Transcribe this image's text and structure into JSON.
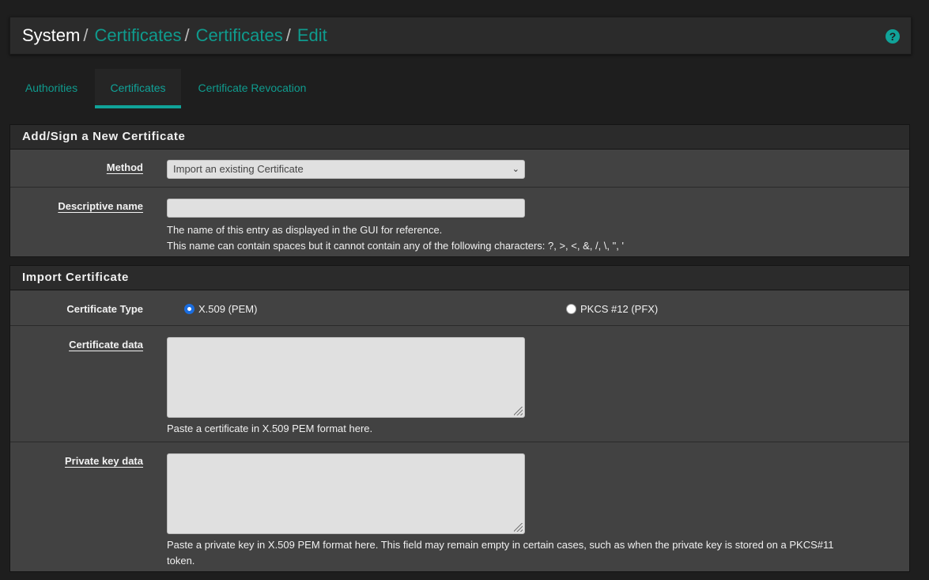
{
  "breadcrumb": {
    "system": "System",
    "sep": "/",
    "certificates_1": "Certificates",
    "certificates_2": "Certificates",
    "edit": "Edit"
  },
  "help_icon": "question-circle-icon",
  "tabs": [
    {
      "label": "Authorities",
      "active": false
    },
    {
      "label": "Certificates",
      "active": true
    },
    {
      "label": "Certificate Revocation",
      "active": false
    }
  ],
  "add_sign": {
    "heading": "Add/Sign a New Certificate",
    "method_label": "Method",
    "method_value": "Import an existing Certificate",
    "descr_label": "Descriptive name",
    "descr_value": "",
    "descr_help_1": "The name of this entry as displayed in the GUI for reference.",
    "descr_help_2": "This name can contain spaces but it cannot contain any of the following characters: ?, >, <, &, /, \\, \", '"
  },
  "import": {
    "heading": "Import Certificate",
    "type_label": "Certificate Type",
    "type_options": [
      {
        "label": "X.509 (PEM)",
        "checked": true
      },
      {
        "label": "PKCS #12 (PFX)",
        "checked": false
      }
    ],
    "cert_label": "Certificate data",
    "cert_value": "",
    "cert_help": "Paste a certificate in X.509 PEM format here.",
    "key_label": "Private key data",
    "key_value": "",
    "key_help_1": "Paste a private key in X.509 PEM format here. This field may remain empty in certain cases, such as when the private key is stored on a PKCS#11",
    "key_help_2": "token."
  },
  "colors": {
    "accent": "#10a399",
    "link": "#0f9b8e",
    "panel": "#424242",
    "heading": "#2b2b2b",
    "radio_checked": "#1a6de0"
  }
}
